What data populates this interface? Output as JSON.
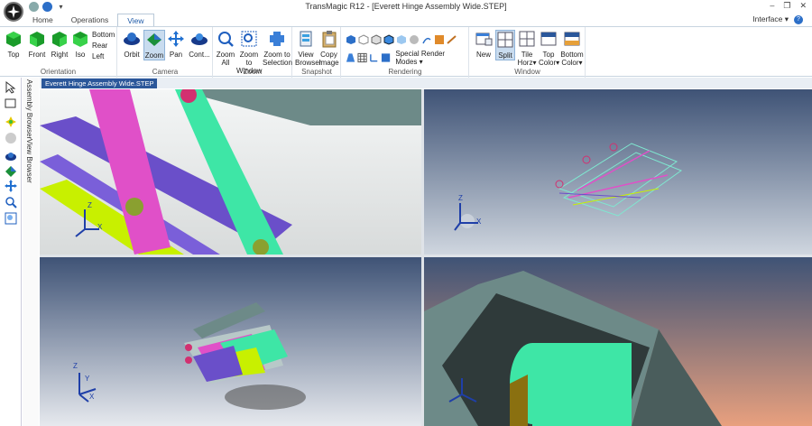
{
  "window": {
    "title": "TransMagic R12 - [Everett Hinge Assembly Wide.STEP]",
    "controls": {
      "minimize": "–",
      "restore": "❐",
      "close": "✕"
    }
  },
  "tabs": [
    {
      "label": "Home"
    },
    {
      "label": "Operations"
    },
    {
      "label": "View",
      "active": true
    }
  ],
  "interface_menu": "Interface ▾",
  "help_glyph": "?",
  "ribbon": {
    "orientation": {
      "label": "Orientation",
      "buttons": [
        "Top",
        "Front",
        "Right",
        "Iso"
      ],
      "small": [
        "Bottom",
        "Rear",
        "Left"
      ]
    },
    "camera": {
      "label": "Camera",
      "buttons": [
        "Orbit",
        "Zoom",
        "Pan",
        "Cont..."
      ]
    },
    "zoom": {
      "label": "Zoom",
      "buttons": [
        [
          "Zoom",
          "All"
        ],
        [
          "Zoom to",
          "Window"
        ],
        [
          "Zoom to",
          "Selection"
        ]
      ]
    },
    "snapshot": {
      "label": "Snapshot",
      "buttons": [
        [
          "View",
          "Browser"
        ],
        [
          "Copy",
          "Image"
        ]
      ]
    },
    "rendering": {
      "label": "Rendering",
      "special": "Special Render Modes ▾"
    },
    "window": {
      "label": "Window",
      "buttons": [
        [
          "New",
          ""
        ],
        [
          "Split",
          ""
        ],
        [
          "Tile",
          "Horz▾"
        ],
        [
          "Top",
          "Color▾"
        ],
        [
          "Bottom",
          "Color▾"
        ]
      ]
    }
  },
  "document_tab": "Everett Hinge Assembly Wide.STEP",
  "side_panels": {
    "assembly": "Assembly Browser",
    "view": "View Browser"
  },
  "triad": {
    "x": "X",
    "y": "Y",
    "z": "Z"
  },
  "colors": {
    "accent": "#2b579a",
    "magenta": "#e050c8",
    "green": "#3ee6a6",
    "purple": "#6a4fc9",
    "yellow": "#c8f000",
    "gray_part": "#6d8a88"
  }
}
